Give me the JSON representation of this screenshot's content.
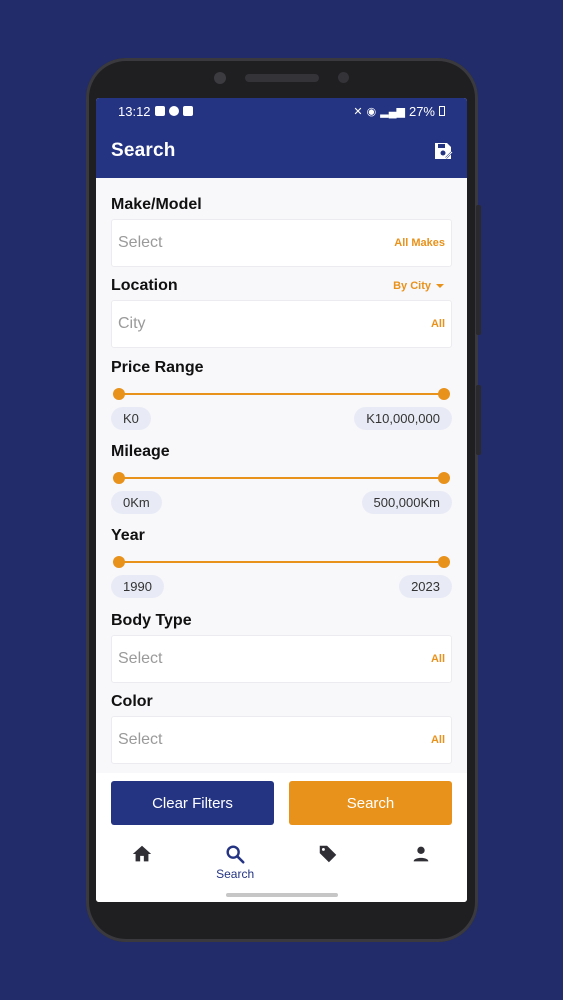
{
  "status_bar": {
    "time": "13:12",
    "battery": "27%"
  },
  "appbar": {
    "title": "Search"
  },
  "sections": {
    "make_model": {
      "label": "Make/Model",
      "placeholder": "Select",
      "tag": "All Makes"
    },
    "location": {
      "label": "Location",
      "filter": "By City",
      "placeholder": "City",
      "tag": "All"
    },
    "price": {
      "label": "Price Range",
      "min": "K0",
      "max": "K10,000,000"
    },
    "mileage": {
      "label": "Mileage",
      "min": "0Km",
      "max": "500,000Km"
    },
    "year": {
      "label": "Year",
      "min": "1990",
      "max": "2023"
    },
    "body_type": {
      "label": "Body Type",
      "placeholder": "Select",
      "tag": "All"
    },
    "color": {
      "label": "Color",
      "placeholder": "Select",
      "tag": "All"
    }
  },
  "actions": {
    "clear": "Clear Filters",
    "search": "Search"
  },
  "nav": {
    "items": [
      {
        "icon": "home-icon",
        "label": ""
      },
      {
        "icon": "search-icon",
        "label": "Search"
      },
      {
        "icon": "tag-icon",
        "label": ""
      },
      {
        "icon": "person-icon",
        "label": ""
      }
    ]
  },
  "colors": {
    "primary": "#243483",
    "accent": "#e8921b",
    "background": "#222c6a"
  }
}
